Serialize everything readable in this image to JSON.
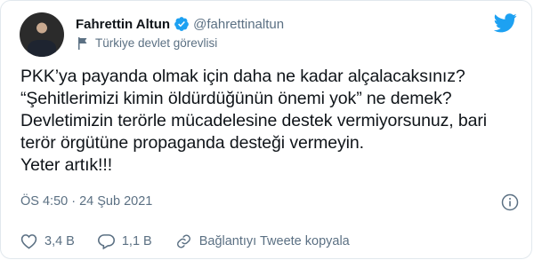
{
  "author": {
    "name": "Fahrettin Altun",
    "handle": "@fahrettinaltun",
    "label": "Türkiye devlet görevlisi"
  },
  "tweet": {
    "lines": [
      "PKK’ya payanda olmak için daha ne kadar alçalacaksınız?",
      "“Şehitlerimizi kimin öldürdüğünün önemi yok” ne demek?",
      "Devletimizin terörle mücadelesine destek vermiyorsunuz, bari",
      "terör örgütüne propaganda desteği vermeyin.",
      "Yeter artık!!!"
    ],
    "timestamp": "ÖS 4:50 · 24 Şub 2021"
  },
  "actions": {
    "likes": "3,4 B",
    "replies": "1,1 B",
    "copy_link": "Bağlantıyı Tweete kopyala"
  },
  "icons": [
    "verified-badge-icon",
    "flag-icon",
    "twitter-bird-icon",
    "info-icon",
    "heart-icon",
    "reply-icon",
    "link-icon"
  ],
  "colors": {
    "accent": "#1da1f2",
    "muted": "#5b7083",
    "text": "#0f1419"
  }
}
